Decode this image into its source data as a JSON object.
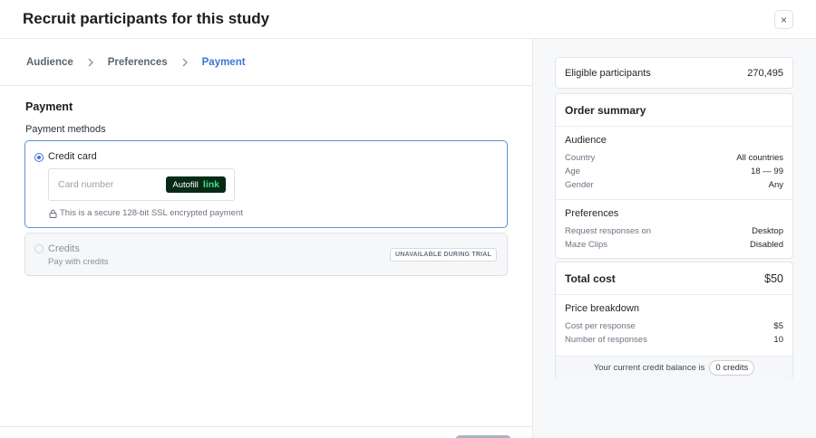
{
  "header": {
    "title": "Recruit participants for this study",
    "close_glyph": "×"
  },
  "stepper": {
    "steps": [
      {
        "label": "Audience"
      },
      {
        "label": "Preferences"
      },
      {
        "label": "Payment"
      }
    ]
  },
  "payment": {
    "title": "Payment",
    "methods_label": "Payment methods",
    "credit_card": {
      "label": "Credit card",
      "card_placeholder": "Card number",
      "autofill_text": "Autofill",
      "autofill_brand": "link",
      "secure_note": "This is a secure 128-bit SSL encrypted payment"
    },
    "credits": {
      "label": "Credits",
      "sublabel": "Pay with credits",
      "badge": "UNAVAILABLE DURING TRIAL"
    }
  },
  "eligible": {
    "label": "Eligible participants",
    "value": "270,495"
  },
  "summary": {
    "title": "Order summary",
    "audience": {
      "title": "Audience",
      "rows": [
        {
          "k": "Country",
          "v": "All countries"
        },
        {
          "k": "Age",
          "v": "18 — 99"
        },
        {
          "k": "Gender",
          "v": "Any"
        }
      ]
    },
    "preferences": {
      "title": "Preferences",
      "rows": [
        {
          "k": "Request responses on",
          "v": "Desktop"
        },
        {
          "k": "Maze Clips",
          "v": "Disabled"
        }
      ]
    }
  },
  "total": {
    "label": "Total cost",
    "value": "$50",
    "breakdown": {
      "title": "Price breakdown",
      "rows": [
        {
          "k": "Cost per response",
          "v": "$5"
        },
        {
          "k": "Number of responses",
          "v": "10"
        }
      ]
    },
    "balance_text": "Your current credit balance is",
    "balance_value": "0 credits"
  },
  "colors": {
    "accent": "#3b76d6",
    "link_green": "#3fe08a",
    "link_bg": "#062a16"
  }
}
